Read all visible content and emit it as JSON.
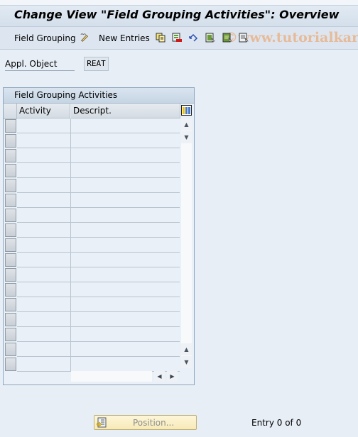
{
  "title": "Change View \"Field Grouping Activities\": Overview",
  "toolbar": {
    "field_grouping_label": "Field Grouping",
    "new_entries_label": "New Entries",
    "icons": [
      "display-change-icon",
      "copy-icon",
      "delete-icon",
      "undo-icon",
      "select-all-icon",
      "select-block-icon",
      "deselect-all-icon"
    ]
  },
  "watermark": "©www.tutorialkart.com",
  "appl_object": {
    "label": "Appl. Object",
    "value": "REAT"
  },
  "table": {
    "title": "Field Grouping Activities",
    "columns": [
      "Activity",
      "Descript."
    ],
    "rows": [
      [
        "",
        ""
      ],
      [
        "",
        ""
      ],
      [
        "",
        ""
      ],
      [
        "",
        ""
      ],
      [
        "",
        ""
      ],
      [
        "",
        ""
      ],
      [
        "",
        ""
      ],
      [
        "",
        ""
      ],
      [
        "",
        ""
      ],
      [
        "",
        ""
      ],
      [
        "",
        ""
      ],
      [
        "",
        ""
      ],
      [
        "",
        ""
      ],
      [
        "",
        ""
      ],
      [
        "",
        ""
      ],
      [
        "",
        ""
      ],
      [
        "",
        ""
      ]
    ]
  },
  "footer": {
    "position_label": "Position...",
    "entry_text": "Entry 0 of 0"
  },
  "colors": {
    "background": "#e7eef6",
    "accent_button": "#f7eab8"
  }
}
